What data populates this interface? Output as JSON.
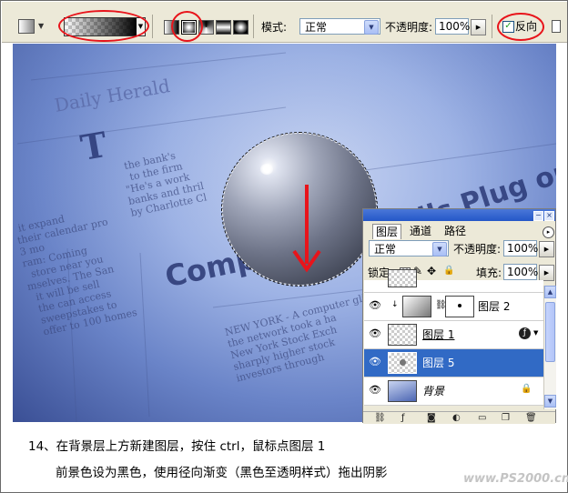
{
  "options_bar": {
    "mode_label": "模式:",
    "mode_value": "正常",
    "opacity_label": "不透明度:",
    "opacity_value": "100%",
    "reverse_label": "反向",
    "reverse_checked": true,
    "gradient_types": [
      "linear",
      "radial",
      "angle",
      "reflected",
      "diamond"
    ],
    "selected_gradient_type": "radial"
  },
  "canvas": {
    "newspaper_headline": "Compuler Glitc",
    "newspaper_headline2": "Pulls Plug on",
    "newspaper_snippet": "Daily Herald",
    "drop_cap": "T"
  },
  "layers_panel": {
    "tabs": [
      "图层",
      "通道",
      "路径"
    ],
    "active_tab": "图层",
    "blend_mode": "正常",
    "opacity_label": "不透明度:",
    "opacity_value": "100%",
    "lock_label": "锁定:",
    "fill_label": "填充:",
    "fill_value": "100%",
    "layers": [
      {
        "name": "图层 2",
        "selected": false,
        "has_mask": true
      },
      {
        "name": "图层 1",
        "selected": false,
        "has_mask": false
      },
      {
        "name": "图层 5",
        "selected": true,
        "has_mask": false
      },
      {
        "name": "背景",
        "selected": false,
        "locked": true
      }
    ]
  },
  "caption": {
    "line1": "14、在背景层上方新建图层，按住 ctrl，鼠标点图层 1",
    "line2": "前景色设为黑色，使用径向渐变（黑色至透明样式）拖出阴影"
  },
  "watermark": "www.PS2000.cn",
  "colors": {
    "annotation_red": "#e8141b",
    "selection_blue": "#316ac5",
    "panel_bg": "#ece9d8"
  }
}
